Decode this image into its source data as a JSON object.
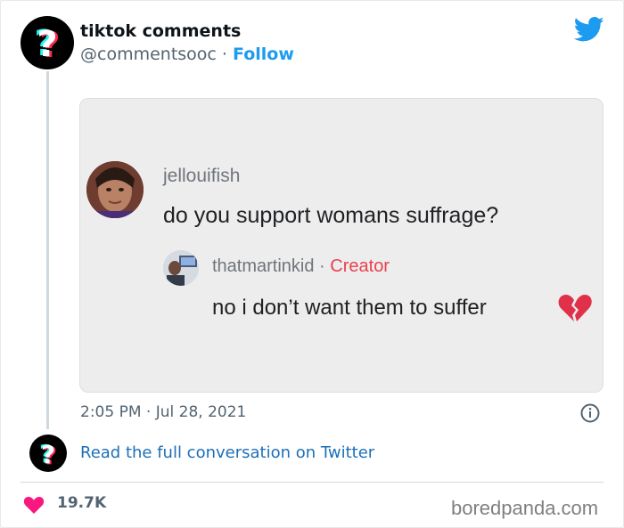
{
  "tweet": {
    "account_name": "tiktok comments",
    "handle": "@commentsooc",
    "separator": " · ",
    "follow_label": "Follow",
    "timestamp": "2:05 PM · Jul 28, 2021",
    "read_more_label": "Read the full conversation on Twitter",
    "like_count": "19.7K"
  },
  "embedded_image": {
    "comment": {
      "username": "jellouifish",
      "text": "do you support womans suffrage?"
    },
    "reply": {
      "username": "thatmartinkid",
      "separator": " · ",
      "badge": "Creator",
      "text": "no i don’t want them to suffer"
    }
  },
  "watermark": "boredpanda.com",
  "icons": {
    "avatar": "tiktok-question-mark-icon",
    "platform": "twitter-bird-icon",
    "info": "info-icon",
    "like": "heart-icon",
    "reply_emoji": "broken-heart-icon"
  },
  "colors": {
    "twitter_blue": "#1d9bf0",
    "like_red": "#f91880",
    "creator_red": "#e8414e"
  }
}
